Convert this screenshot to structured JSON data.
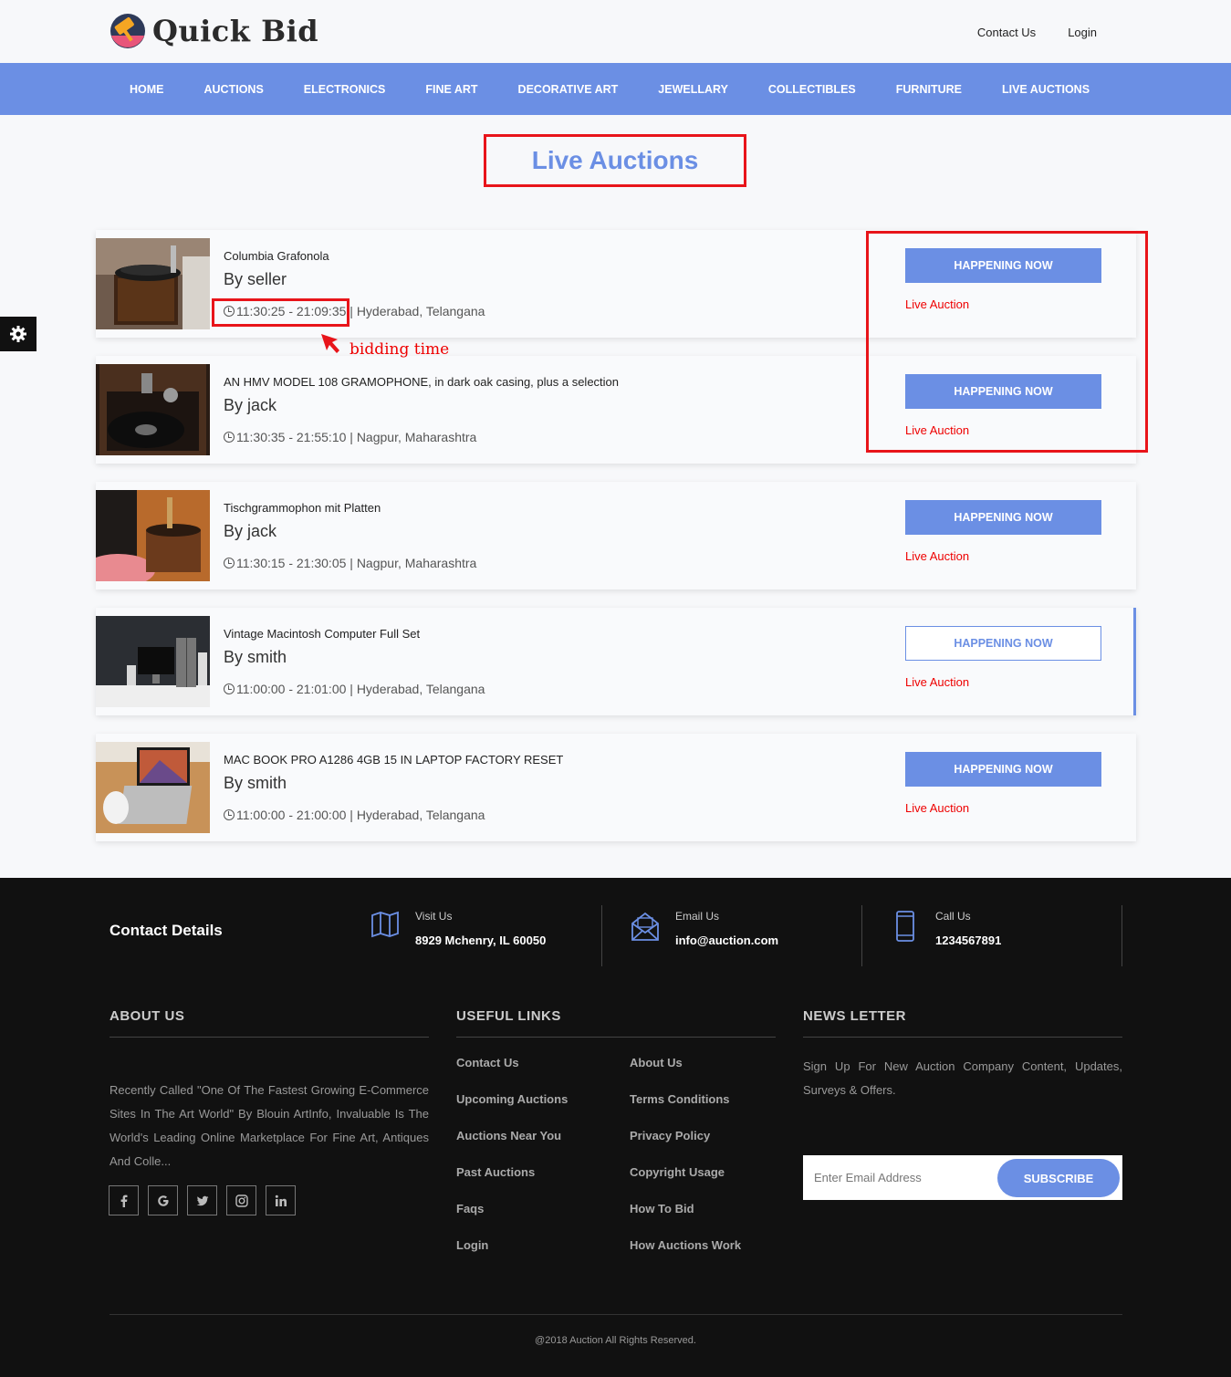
{
  "header": {
    "brand": "Quick Bid",
    "links": [
      "Contact Us",
      "Login"
    ]
  },
  "nav": [
    "HOME",
    "AUCTIONS",
    "ELECTRONICS",
    "FINE ART",
    "DECORATIVE ART",
    "JEWELLARY",
    "COLLECTIBLES",
    "FURNITURE",
    "LIVE AUCTIONS"
  ],
  "page_title": "Live Auctions",
  "annotation": "bidding time",
  "auctions": [
    {
      "title": "Columbia Grafonola",
      "seller": "By seller",
      "time": "11:30:25 - 21:09:35",
      "location": "| Hyderabad, Telangana",
      "button": "HAPPENING NOW",
      "status": "Live Auction"
    },
    {
      "title": "AN HMV MODEL 108 GRAMOPHONE, in dark oak casing, plus a selection",
      "seller": "By jack",
      "time": "11:30:35 - 21:55:10",
      "location": "| Nagpur, Maharashtra",
      "button": "HAPPENING NOW",
      "status": "Live Auction"
    },
    {
      "title": "Tischgrammophon mit Platten",
      "seller": "By jack",
      "time": "11:30:15 - 21:30:05",
      "location": "| Nagpur, Maharashtra",
      "button": "HAPPENING NOW",
      "status": "Live Auction"
    },
    {
      "title": "Vintage Macintosh Computer Full Set",
      "seller": "By smith",
      "time": "11:00:00 - 21:01:00",
      "location": "| Hyderabad, Telangana",
      "button": "HAPPENING NOW",
      "status": "Live Auction"
    },
    {
      "title": "MAC BOOK PRO A1286 4GB 15 IN LAPTOP FACTORY RESET",
      "seller": "By smith",
      "time": "11:00:00 - 21:00:00",
      "location": "| Hyderabad, Telangana",
      "button": "HAPPENING NOW",
      "status": "Live Auction"
    }
  ],
  "footer": {
    "contact_title": "Contact Details",
    "visit": {
      "label": "Visit Us",
      "value": "8929 Mchenry, IL 60050",
      "icon": "map-icon"
    },
    "email": {
      "label": "Email Us",
      "value": "info@auction.com",
      "icon": "envelope-icon"
    },
    "call": {
      "label": "Call Us",
      "value": "1234567891",
      "icon": "mobile-icon"
    },
    "about_heading": "ABOUT US",
    "about_text": "Recently Called \"One Of The Fastest Growing E-Commerce Sites In The Art World\" By Blouin ArtInfo, Invaluable Is The World's Leading Online Marketplace For Fine Art, Antiques And Colle...",
    "social_icons": [
      "facebook-icon",
      "google-icon",
      "twitter-icon",
      "instagram-icon",
      "linkedin-icon"
    ],
    "links_heading": "USEFUL LINKS",
    "links_col1": [
      "Contact Us",
      "Upcoming Auctions",
      "Auctions Near You",
      "Past Auctions",
      "Faqs",
      "Login"
    ],
    "links_col2": [
      "About Us",
      "Terms Conditions",
      "Privacy Policy",
      "Copyright Usage",
      "How To Bid",
      "How Auctions Work"
    ],
    "news_heading": "NEWS LETTER",
    "news_text": "Sign Up For New Auction Company Content, Updates, Surveys & Offers.",
    "email_placeholder": "Enter Email Address",
    "subscribe": "SUBSCRIBE",
    "copyright": "@2018 Auction All Rights Reserved."
  },
  "colors": {
    "accent": "#6b8fe4",
    "live": "#e00000",
    "annotation": "#e8141a",
    "footer_bg": "#111111"
  }
}
